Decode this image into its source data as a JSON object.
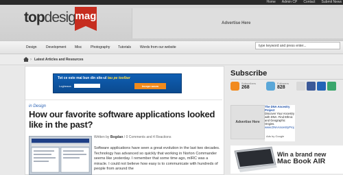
{
  "toplinks": [
    "Home",
    "Admin CP",
    "Contact",
    "Submit News"
  ],
  "logo": {
    "part1": "top",
    "part2": "design",
    "badge": "mag"
  },
  "header_ad": "Advertise Here",
  "nav": [
    "Design",
    "Development",
    "Misc",
    "Photography",
    "Tutorials",
    "Words from our website"
  ],
  "search": {
    "placeholder": "type keyword and press enter..."
  },
  "breadcrumb": {
    "sep": "›",
    "label": "Latest Articles and Resources"
  },
  "banner": {
    "line_a": "Tot ce este mai bun din site-ul ",
    "line_b": "tau pe toolbar",
    "label": "Logheaza",
    "button": "Incepe acum"
  },
  "post": {
    "category": "in Design",
    "title": "How our favorite software applications looked like in the past?",
    "meta_prefix": "Written by ",
    "author": "Bogdan",
    "meta_suffix": " / 0 Comments and 4 Reactions",
    "excerpt": "Software applications have seen a great evolution in the last two decades. Technology has advanced so quickly that working in Norton Commander seems like yesterday. I remember that some time ago, mIRC was a miracle. I could not believe how easy is to communicate with hundreds of people from around the"
  },
  "subscribe": {
    "title": "Subscribe",
    "subscribers_label": "Subscribers",
    "subscribers": "268",
    "followers_label": "Followers",
    "followers": "828"
  },
  "side_ad": "Advertise Here",
  "dna_ad": {
    "head": "The DNA Ancestry Project",
    "body": "Discover Your Ancestry with DNA. Find Ethnic and Geographic Origins.",
    "url": "www.DNAAncestryProj"
  },
  "ads_by": "Ads by Google",
  "mac_ad": {
    "line1": "Win a brand new",
    "line2": "Mac Book AIR"
  },
  "colors": {
    "accent_red": "#c62d1f",
    "link_blue": "#2a62b4"
  }
}
